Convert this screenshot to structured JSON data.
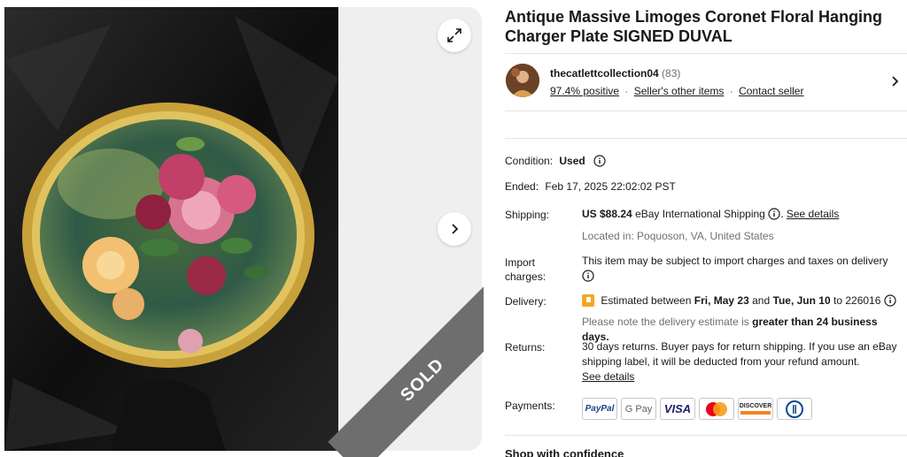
{
  "listing": {
    "title": "Antique Massive Limoges Coronet Floral Hanging Charger Plate SIGNED DUVAL",
    "sold_badge": "SOLD"
  },
  "seller": {
    "name": "thecatlettcollection04",
    "count": "(83)",
    "positive": "97.4% positive",
    "other_items": "Seller's other items",
    "contact": "Contact seller",
    "separator": "·"
  },
  "details": {
    "condition_label": "Condition:",
    "condition_value": "Used",
    "ended_label": "Ended:",
    "ended_value": "Feb 17, 2025 22:02:02 PST",
    "shipping_label": "Shipping:",
    "shipping_price": "US $88.24",
    "shipping_method": "eBay International Shipping",
    "shipping_details": "See details",
    "located": "Located in: Poquoson, VA, United States",
    "import_label_1": "Import",
    "import_label_2": "charges:",
    "import_text": "This item may be subject to import charges and taxes on delivery",
    "delivery_label": "Delivery:",
    "delivery_pre": "Estimated between",
    "delivery_from": "Fri, May 23",
    "delivery_and": "and",
    "delivery_to": "Tue, Jun 10",
    "delivery_to_word": "to",
    "delivery_zip": "226016",
    "delivery_note_pre": "Please note the delivery estimate is",
    "delivery_note_bold": "greater than 24 business days.",
    "returns_label": "Returns:",
    "returns_line1": "30 days returns. Buyer pays for return shipping. If you use an eBay",
    "returns_line2": "shipping label, it will be deducted from your refund amount.",
    "returns_link": "See details",
    "payments_label": "Payments:"
  },
  "payments": {
    "paypal": "PayPal",
    "gpay": "G Pay",
    "visa": "VISA",
    "discover": "DISCOVER"
  },
  "shop_confidence": "Shop with confidence",
  "colors": {
    "accent_orange": "#f5a623",
    "text": "#191919",
    "muted": "#707070",
    "sold_band": "#6e6e6e"
  }
}
